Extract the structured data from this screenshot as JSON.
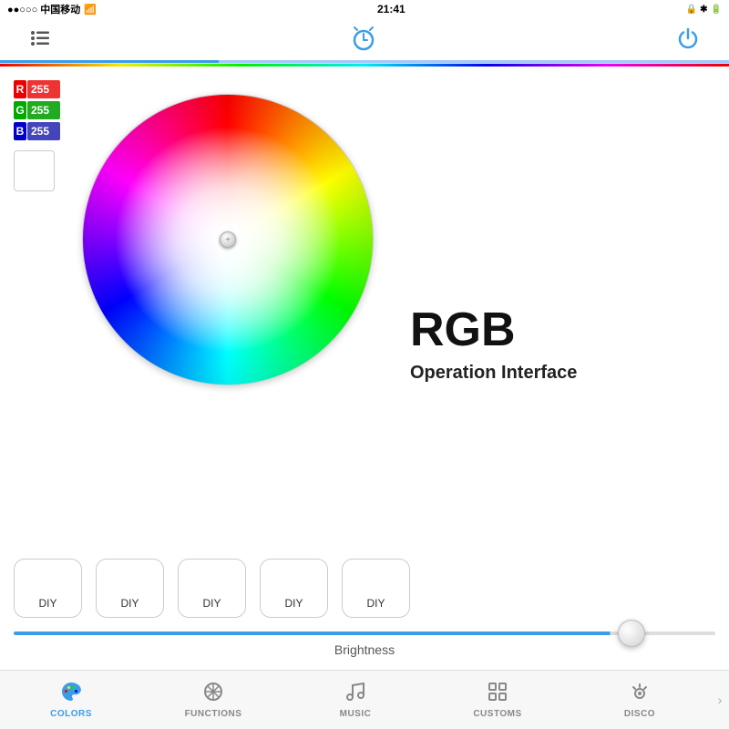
{
  "statusBar": {
    "carrier": "●●○○○ 中国移动",
    "wifi": "WiFi",
    "time": "21:41",
    "battery": "Battery"
  },
  "nav": {
    "hamburger": "☰",
    "alarmLabel": "alarm-icon",
    "powerLabel": "power-icon"
  },
  "rgb": {
    "r_label": "R",
    "g_label": "G",
    "b_label": "B",
    "r_value": "255",
    "g_value": "255",
    "b_value": "255"
  },
  "mainTitle": "RGB",
  "subtitle": "Operation Interface",
  "diy": {
    "buttons": [
      "DIY",
      "DIY",
      "DIY",
      "DIY",
      "DIY"
    ]
  },
  "brightness": {
    "label": "Brightness"
  },
  "tabs": [
    {
      "id": "colors",
      "label": "COLORS",
      "icon": "colors",
      "active": true
    },
    {
      "id": "functions",
      "label": "FUNCTIONS",
      "icon": "functions",
      "active": false
    },
    {
      "id": "music",
      "label": "MUSIC",
      "icon": "music",
      "active": false
    },
    {
      "id": "customs",
      "label": "CUSTOMS",
      "icon": "customs",
      "active": false
    },
    {
      "id": "disco",
      "label": "DISCO",
      "icon": "disco",
      "active": false
    }
  ]
}
